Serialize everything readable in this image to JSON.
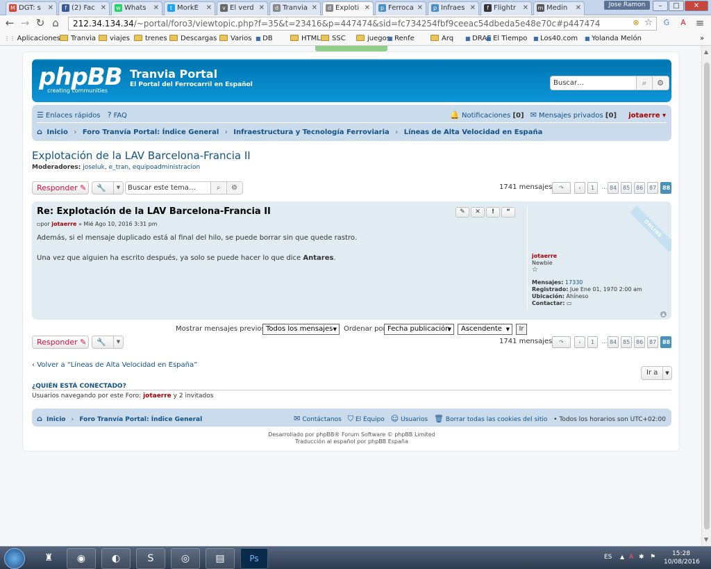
{
  "browser": {
    "tabs": [
      {
        "label": "DGT: s",
        "fav": "M",
        "color": "#d44638"
      },
      {
        "label": "(2) Fac",
        "fav": "f",
        "color": "#3b5998"
      },
      {
        "label": "Whats",
        "fav": "w",
        "color": "#25d366"
      },
      {
        "label": "MorkE",
        "fav": "t",
        "color": "#1da1f2"
      },
      {
        "label": "El verd",
        "fav": "v",
        "color": "#666666"
      },
      {
        "label": "Tranvia",
        "fav": "d",
        "color": "#888888"
      },
      {
        "label": "Exploti",
        "fav": "d",
        "color": "#888888"
      },
      {
        "label": "Ferroca",
        "fav": "p",
        "color": "#4a90c2"
      },
      {
        "label": "Infraes",
        "fav": "p",
        "color": "#4a90c2"
      },
      {
        "label": "Flightr",
        "fav": "f",
        "color": "#333333"
      },
      {
        "label": "Medin",
        "fav": "m",
        "color": "#555555"
      }
    ],
    "user_label": "Jose Ramon",
    "url_host": "212.34.134.34",
    "url_rest": "/~portal/foro3/viewtopic.php?f=35&t=23416&p=447474&sid=fc734254fbf9ceeac54dbeda5e48e70c#p447474",
    "bookmarks": [
      "Aplicaciones",
      "Tranvia",
      "viajes",
      "trenes",
      "Descargas",
      "Varios",
      "DB",
      "HTML",
      "SSC",
      "juegos",
      "Renfe",
      "Arq",
      "DRAE",
      "El Tiempo",
      "Los40.com",
      "Yolanda Melón"
    ]
  },
  "site": {
    "logo_text": "phpBB",
    "logo_sub": "creating communities",
    "title": "Tranvia Portal",
    "description": "El Portal del Ferrocarril en Español",
    "search_placeholder": "Buscar…"
  },
  "navbar": {
    "quick_links": "Enlaces rápidos",
    "faq": "FAQ",
    "notifications": "Notificaciones",
    "notifications_count": "[0]",
    "pm": "Mensajes privados",
    "pm_count": "[0]",
    "user": "jotaerre"
  },
  "breadcrumb": [
    "Inicio",
    "Foro Tranvía Portal: Índice General",
    "Infraestructura y Tecnología Ferroviaria",
    "Líneas de Alta Velocidad en España"
  ],
  "topic": {
    "title": "Explotación de la LAV Barcelona-Francia II",
    "moderators_label": "Moderadores:",
    "moderators": "joseluk, e_tran, equipoadministracion"
  },
  "actions": {
    "reply": "Responder",
    "search_topic_placeholder": "Buscar este tema…",
    "post_count": "1741 mensajes",
    "pages": [
      "1",
      "…",
      "84",
      "85",
      "86",
      "87",
      "88"
    ],
    "current_page": "88"
  },
  "post": {
    "title": "Re: Explotación de la LAV Barcelona-Francia II",
    "by_label": "por",
    "author": "jotaerre",
    "date": "» Mié Ago 10, 2016 3:31 pm",
    "paragraph1": "Además, si el mensaje duplicado está al final del hilo, se puede borrar sin que quede rastro.",
    "paragraph2_pre": "Una vez que alguien ha escrito después, ya solo se puede hacer lo que dice",
    "paragraph2_bold": "Antares",
    "paragraph2_post": ".",
    "online_badge": "ONLINE",
    "profile": {
      "name": "jotaerre",
      "rank": "Newbie",
      "posts_label": "Mensajes:",
      "posts": "17330",
      "joined_label": "Registrado:",
      "joined": "Jue Ene 01, 1970 2:00 am",
      "location_label": "Ubicación:",
      "location": "Ahíneso",
      "contact_label": "Contactar:"
    }
  },
  "sort": {
    "show_label": "Mostrar mensajes previos:",
    "show_value": "Todos los mensajes",
    "order_label": "Ordenar por",
    "order_value": "Fecha publicación",
    "dir_value": "Ascendente",
    "go": "Ir"
  },
  "back_link": "Volver a “Líneas de Alta Velocidad en España”",
  "jump": "Ir a",
  "online": {
    "heading": "¿QUIÉN ESTÁ CONECTADO?",
    "text_pre": "Usuarios navegando por este Foro:",
    "user": "jotaerre",
    "text_post": "y 2 invitados"
  },
  "footer": {
    "home": "Inicio",
    "index": "Foro Tranvía Portal: Índice General",
    "contact": "Contáctanos",
    "team": "El Equipo",
    "users": "Usuarios",
    "cookies": "Borrar todas las cookies del sitio",
    "timezone": "• Todos los horarios son UTC+02:00",
    "powered": "Desarrollado por phpBB® Forum Software © phpBB Limited",
    "translation": "Traducción al español por phpBB España"
  },
  "taskbar": {
    "lang": "ES",
    "time": "15:28",
    "date": "10/08/2016"
  }
}
